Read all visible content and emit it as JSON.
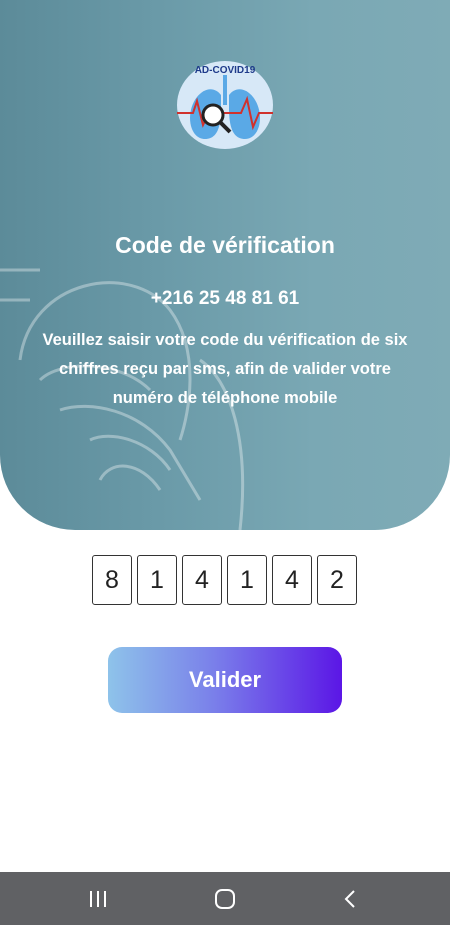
{
  "logo": {
    "text": "AD-COVID19",
    "icon": "lungs-magnifier-logo"
  },
  "verification": {
    "title": "Code de vérification",
    "phone": "+216 25 48 81 61",
    "instructions": "Veuillez saisir votre code du vérification de six chiffres reçu par sms, afin de valider votre numéro de téléphone mobile"
  },
  "code": {
    "digits": [
      "8",
      "1",
      "4",
      "1",
      "4",
      "2"
    ]
  },
  "actions": {
    "submit_label": "Valider"
  },
  "navbar": {
    "icons": [
      "recent-apps-icon",
      "home-icon",
      "back-icon"
    ]
  },
  "colors": {
    "hero": "#6a9aa8",
    "button_start": "#8ec3ea",
    "button_end": "#5b16e6",
    "navbar": "#606164"
  }
}
